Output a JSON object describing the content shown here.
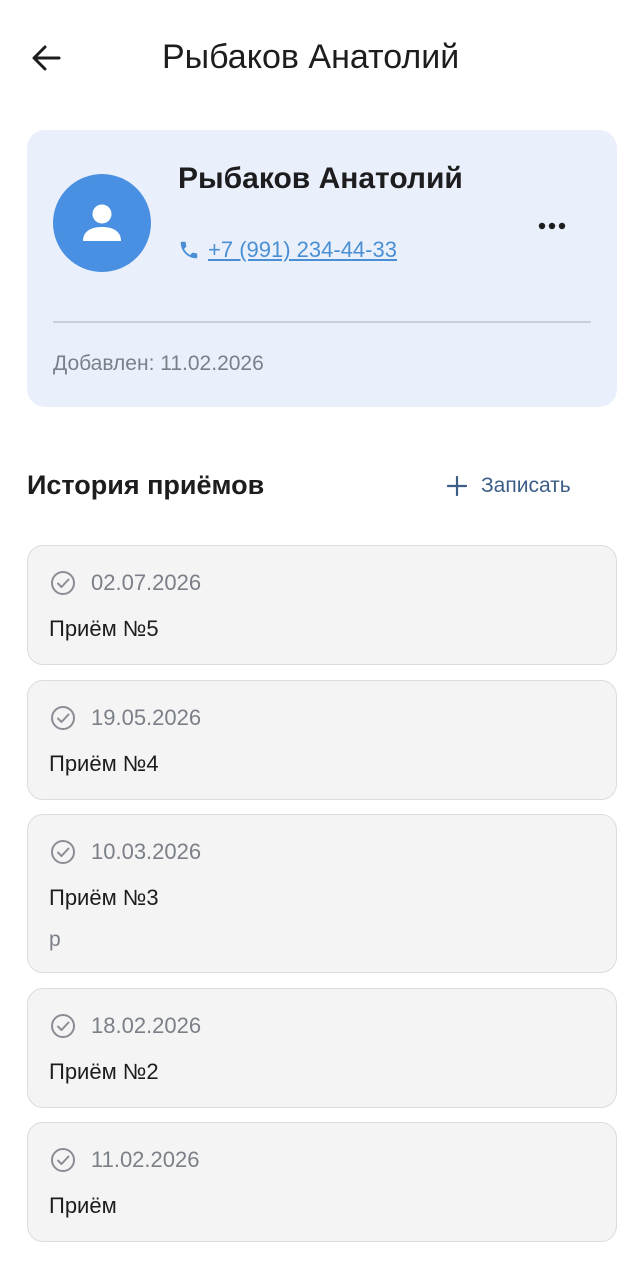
{
  "header": {
    "title": "Рыбаков Анатолий",
    "back_icon": "arrow-left-icon"
  },
  "patient": {
    "name": "Рыбаков Анатолий",
    "phone": "+7 (991) 234-44-33",
    "added": "Добавлен: 11.02.2026",
    "avatar_color": "#4a90e2",
    "card_bg": "#e9f0fb",
    "avatar_icon": "person-icon",
    "phone_icon": "phone-icon",
    "more_icon": "more-horizontal-icon"
  },
  "history": {
    "title": "История приёмов",
    "book_label": "Записать",
    "book_icon": "plus-icon",
    "status_icon": "check-circle-icon",
    "visits": [
      {
        "date": "02.07.2026",
        "title": "Приём №5",
        "note": ""
      },
      {
        "date": "19.05.2026",
        "title": "Приём №4",
        "note": ""
      },
      {
        "date": "10.03.2026",
        "title": "Приём №3",
        "note": "р"
      },
      {
        "date": "18.02.2026",
        "title": "Приём №2",
        "note": ""
      },
      {
        "date": "11.02.2026",
        "title": "Приём",
        "note": ""
      }
    ]
  }
}
